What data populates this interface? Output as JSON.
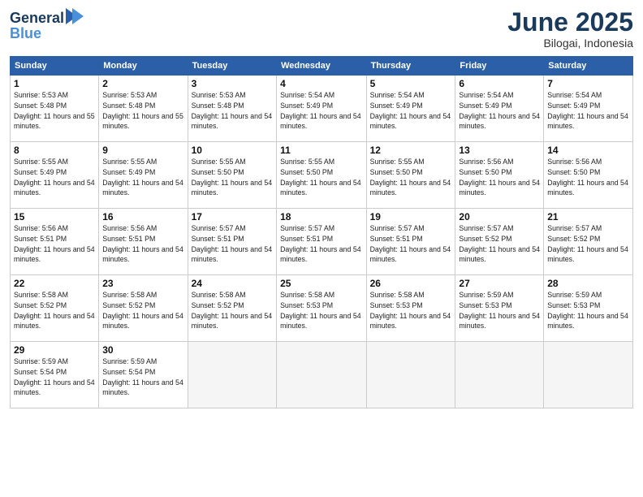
{
  "logo": {
    "line1": "General",
    "line2": "Blue"
  },
  "title": "June 2025",
  "location": "Bilogai, Indonesia",
  "days_of_week": [
    "Sunday",
    "Monday",
    "Tuesday",
    "Wednesday",
    "Thursday",
    "Friday",
    "Saturday"
  ],
  "weeks": [
    [
      {
        "num": "1",
        "rise": "5:53 AM",
        "set": "5:48 PM",
        "daylight": "11 hours and 55 minutes."
      },
      {
        "num": "2",
        "rise": "5:53 AM",
        "set": "5:48 PM",
        "daylight": "11 hours and 55 minutes."
      },
      {
        "num": "3",
        "rise": "5:53 AM",
        "set": "5:48 PM",
        "daylight": "11 hours and 54 minutes."
      },
      {
        "num": "4",
        "rise": "5:54 AM",
        "set": "5:49 PM",
        "daylight": "11 hours and 54 minutes."
      },
      {
        "num": "5",
        "rise": "5:54 AM",
        "set": "5:49 PM",
        "daylight": "11 hours and 54 minutes."
      },
      {
        "num": "6",
        "rise": "5:54 AM",
        "set": "5:49 PM",
        "daylight": "11 hours and 54 minutes."
      },
      {
        "num": "7",
        "rise": "5:54 AM",
        "set": "5:49 PM",
        "daylight": "11 hours and 54 minutes."
      }
    ],
    [
      {
        "num": "8",
        "rise": "5:55 AM",
        "set": "5:49 PM",
        "daylight": "11 hours and 54 minutes."
      },
      {
        "num": "9",
        "rise": "5:55 AM",
        "set": "5:49 PM",
        "daylight": "11 hours and 54 minutes."
      },
      {
        "num": "10",
        "rise": "5:55 AM",
        "set": "5:50 PM",
        "daylight": "11 hours and 54 minutes."
      },
      {
        "num": "11",
        "rise": "5:55 AM",
        "set": "5:50 PM",
        "daylight": "11 hours and 54 minutes."
      },
      {
        "num": "12",
        "rise": "5:55 AM",
        "set": "5:50 PM",
        "daylight": "11 hours and 54 minutes."
      },
      {
        "num": "13",
        "rise": "5:56 AM",
        "set": "5:50 PM",
        "daylight": "11 hours and 54 minutes."
      },
      {
        "num": "14",
        "rise": "5:56 AM",
        "set": "5:50 PM",
        "daylight": "11 hours and 54 minutes."
      }
    ],
    [
      {
        "num": "15",
        "rise": "5:56 AM",
        "set": "5:51 PM",
        "daylight": "11 hours and 54 minutes."
      },
      {
        "num": "16",
        "rise": "5:56 AM",
        "set": "5:51 PM",
        "daylight": "11 hours and 54 minutes."
      },
      {
        "num": "17",
        "rise": "5:57 AM",
        "set": "5:51 PM",
        "daylight": "11 hours and 54 minutes."
      },
      {
        "num": "18",
        "rise": "5:57 AM",
        "set": "5:51 PM",
        "daylight": "11 hours and 54 minutes."
      },
      {
        "num": "19",
        "rise": "5:57 AM",
        "set": "5:51 PM",
        "daylight": "11 hours and 54 minutes."
      },
      {
        "num": "20",
        "rise": "5:57 AM",
        "set": "5:52 PM",
        "daylight": "11 hours and 54 minutes."
      },
      {
        "num": "21",
        "rise": "5:57 AM",
        "set": "5:52 PM",
        "daylight": "11 hours and 54 minutes."
      }
    ],
    [
      {
        "num": "22",
        "rise": "5:58 AM",
        "set": "5:52 PM",
        "daylight": "11 hours and 54 minutes."
      },
      {
        "num": "23",
        "rise": "5:58 AM",
        "set": "5:52 PM",
        "daylight": "11 hours and 54 minutes."
      },
      {
        "num": "24",
        "rise": "5:58 AM",
        "set": "5:52 PM",
        "daylight": "11 hours and 54 minutes."
      },
      {
        "num": "25",
        "rise": "5:58 AM",
        "set": "5:53 PM",
        "daylight": "11 hours and 54 minutes."
      },
      {
        "num": "26",
        "rise": "5:58 AM",
        "set": "5:53 PM",
        "daylight": "11 hours and 54 minutes."
      },
      {
        "num": "27",
        "rise": "5:59 AM",
        "set": "5:53 PM",
        "daylight": "11 hours and 54 minutes."
      },
      {
        "num": "28",
        "rise": "5:59 AM",
        "set": "5:53 PM",
        "daylight": "11 hours and 54 minutes."
      }
    ],
    [
      {
        "num": "29",
        "rise": "5:59 AM",
        "set": "5:54 PM",
        "daylight": "11 hours and 54 minutes."
      },
      {
        "num": "30",
        "rise": "5:59 AM",
        "set": "5:54 PM",
        "daylight": "11 hours and 54 minutes."
      },
      null,
      null,
      null,
      null,
      null
    ]
  ]
}
